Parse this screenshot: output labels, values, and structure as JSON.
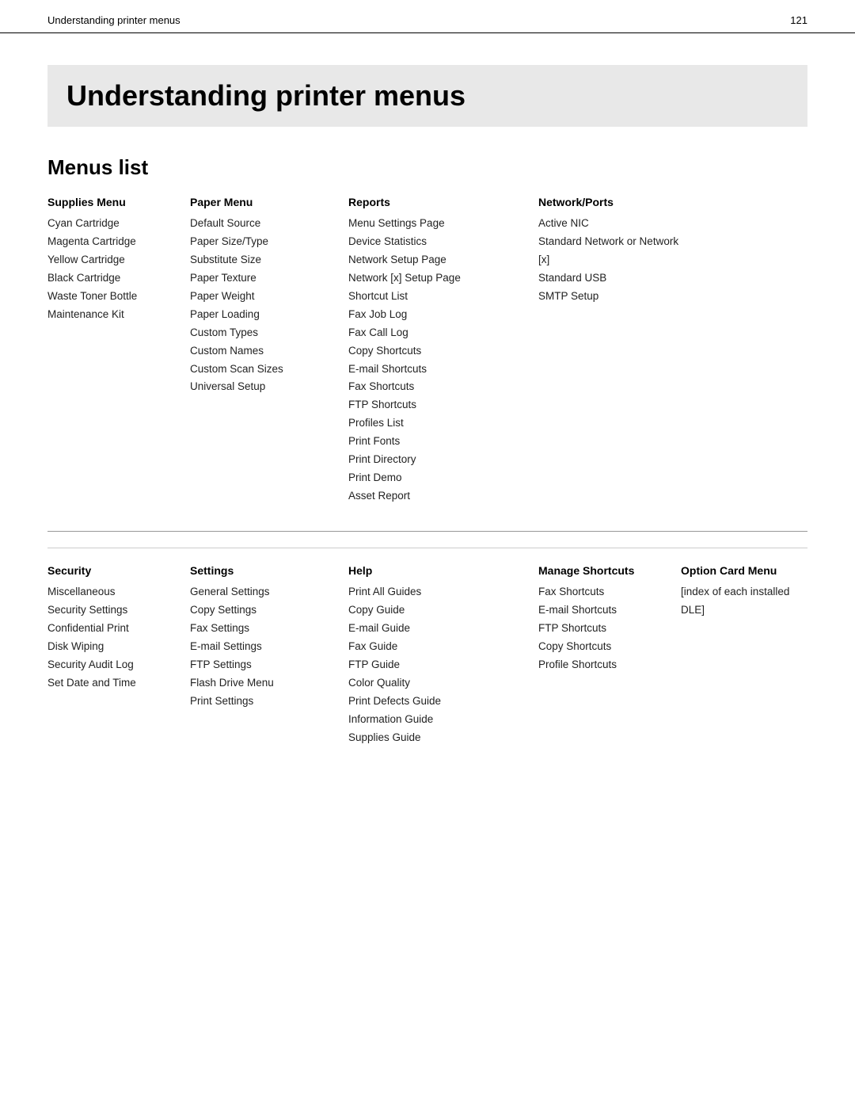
{
  "header": {
    "title": "Understanding printer menus",
    "page_number": "121"
  },
  "main_title": "Understanding printer menus",
  "section_title": "Menus list",
  "top_menus": [
    {
      "id": "supplies-menu",
      "header": "Supplies Menu",
      "items": [
        "Cyan Cartridge",
        "Magenta Cartridge",
        "Yellow Cartridge",
        "Black Cartridge",
        "Waste Toner Bottle",
        "Maintenance Kit"
      ]
    },
    {
      "id": "paper-menu",
      "header": "Paper Menu",
      "items": [
        "Default Source",
        "Paper Size/Type",
        "Substitute Size",
        "Paper Texture",
        "Paper Weight",
        "Paper Loading",
        "Custom Types",
        "Custom Names",
        "Custom Scan Sizes",
        "Universal Setup"
      ]
    },
    {
      "id": "reports-menu",
      "header": "Reports",
      "items": [
        "Menu Settings Page",
        "Device Statistics",
        "Network Setup Page",
        "Network [x] Setup Page",
        "Shortcut List",
        "Fax Job Log",
        "Fax Call Log",
        "Copy Shortcuts",
        "E-mail Shortcuts",
        "Fax Shortcuts",
        "FTP Shortcuts",
        "Profiles List",
        "Print Fonts",
        "Print Directory",
        "Print Demo",
        "Asset Report"
      ]
    },
    {
      "id": "network-ports-menu",
      "header": "Network/Ports",
      "items": [
        "Active NIC",
        "Standard Network or Network [x]",
        "Standard USB",
        "SMTP Setup"
      ]
    }
  ],
  "bottom_menus": [
    {
      "id": "security-menu",
      "header": "Security",
      "items": [
        "Miscellaneous",
        "Security Settings",
        "Confidential Print",
        "Disk Wiping",
        "Security Audit Log",
        "Set Date and Time"
      ]
    },
    {
      "id": "settings-menu",
      "header": "Settings",
      "items": [
        "General Settings",
        "Copy Settings",
        "Fax Settings",
        "E-mail Settings",
        "FTP Settings",
        "Flash Drive Menu",
        "Print Settings"
      ]
    },
    {
      "id": "help-menu",
      "header": "Help",
      "items": [
        "Print All Guides",
        "Copy Guide",
        "E-mail Guide",
        "Fax Guide",
        "FTP Guide",
        "Color Quality",
        "Print Defects Guide",
        "Information Guide",
        "Supplies Guide"
      ]
    },
    {
      "id": "manage-shortcuts-menu",
      "header": "Manage Shortcuts",
      "items": [
        "Fax Shortcuts",
        "E-mail Shortcuts",
        "FTP Shortcuts",
        "Copy Shortcuts",
        "Profile Shortcuts"
      ]
    },
    {
      "id": "option-card-menu",
      "header": "Option Card Menu",
      "items": [
        "[index of each installed DLE]"
      ]
    }
  ]
}
